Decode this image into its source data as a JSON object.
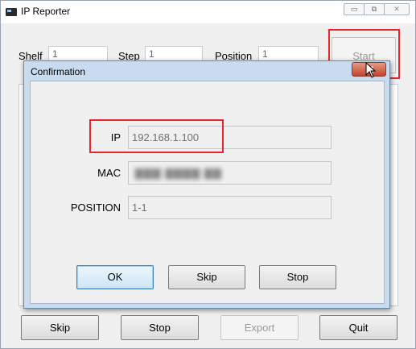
{
  "window": {
    "title": "IP Reporter",
    "controls": {
      "minimize": "▭",
      "maximize": "⧉",
      "close": "✕"
    }
  },
  "form": {
    "shelf_label": "Shelf",
    "shelf_value": "1",
    "step_label": "Step",
    "step_value": "1",
    "position_label": "Position",
    "position_value": "1",
    "start_label": "Start"
  },
  "bottom_buttons": {
    "skip": "Skip",
    "stop": "Stop",
    "export": "Export",
    "quit": "Quit"
  },
  "dialog": {
    "title": "Confirmation",
    "ip_label": "IP",
    "ip_value": "192.168.1.100",
    "mac_label": "MAC",
    "mac_value": "",
    "position_label": "POSITION",
    "position_value": "1-1",
    "ok_label": "OK",
    "skip_label": "Skip",
    "stop_label": "Stop"
  },
  "colors": {
    "highlight": "#e8262c",
    "dialog_frame": "#c9dcef",
    "close_button": "#c4432b"
  },
  "icons": [
    "app-icon",
    "mouse-cursor-icon",
    "close-icon"
  ]
}
